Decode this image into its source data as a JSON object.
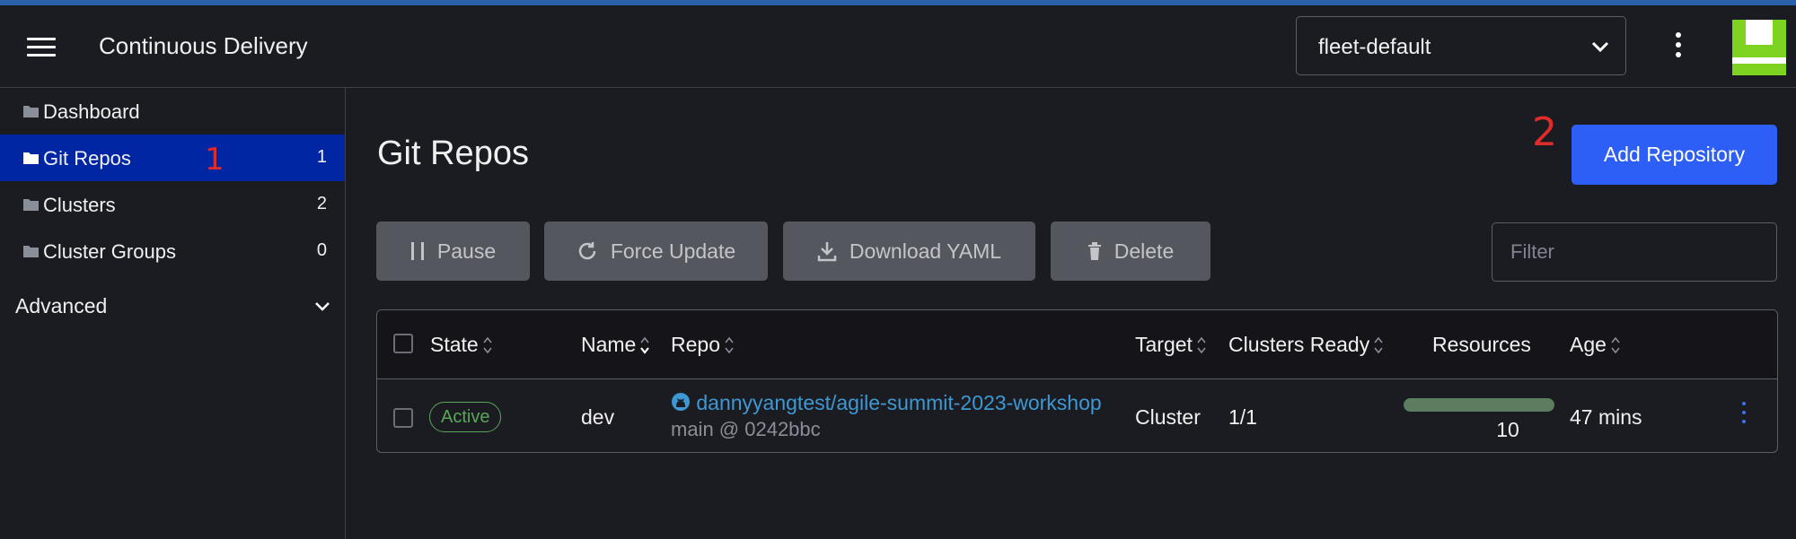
{
  "header": {
    "app_title": "Continuous Delivery",
    "namespace_selected": "fleet-default"
  },
  "sidebar": {
    "items": [
      {
        "label": "Dashboard",
        "count": ""
      },
      {
        "label": "Git Repos",
        "count": "1"
      },
      {
        "label": "Clusters",
        "count": "2"
      },
      {
        "label": "Cluster Groups",
        "count": "0"
      }
    ],
    "advanced_label": "Advanced"
  },
  "annotations": {
    "one": "1",
    "two": "2"
  },
  "main": {
    "title": "Git Repos",
    "add_button": "Add Repository",
    "bulk_actions": {
      "pause": "Pause",
      "force_update": "Force Update",
      "download_yaml": "Download YAML",
      "delete": "Delete"
    },
    "filter_placeholder": "Filter"
  },
  "table": {
    "headers": {
      "state": "State",
      "name": "Name",
      "repo": "Repo",
      "target": "Target",
      "clusters_ready": "Clusters Ready",
      "resources": "Resources",
      "age": "Age"
    },
    "rows": [
      {
        "state": "Active",
        "name": "dev",
        "repo": "dannyyangtest/agile-summit-2023-workshop",
        "branch": "main @ 0242bbc",
        "target": "Cluster",
        "clusters_ready": "1/1",
        "resources": "10",
        "age": "47 mins"
      }
    ]
  },
  "colors": {
    "active_nav": "#0026a4",
    "primary_button": "#2d5ff6",
    "link": "#3d98d3",
    "active_badge": "#5aa55a",
    "annotation": "#e02b2b"
  }
}
